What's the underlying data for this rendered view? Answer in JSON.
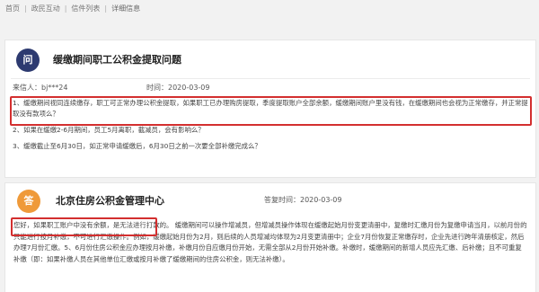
{
  "breadcrumb": {
    "items": [
      "首页",
      "政民互动",
      "信件列表",
      "详细信息"
    ]
  },
  "question": {
    "badge": "问",
    "title": "缓缴期间职工公积金提取问题",
    "sender_label": "来信人：bj***24",
    "time_label": "时间：2020-03-09",
    "items": [
      "1、缓缴期间视同连续缴存，职工可正常办理公积金提取，如果职工已办理购房提取，季度提取账户全部余额，缓缴期间账户里没有钱，在缓缴期间也会视为正常缴存，并正常提取没有款项么？",
      "2、如果在缓缴2-6月期间，员工5月离职，截减员，会有影响么？",
      "3、缓缴截止至6月30日，如正常申请缓缴后，6月30日之前一次要全部补缴完成么？"
    ]
  },
  "answer": {
    "badge": "答",
    "org": "北京住房公积金管理中心",
    "time_label": "答复时间：2020-03-09",
    "highlight": "您好，如果职工账户中没有余额，是无法进行打款的。",
    "body": "缓缴期间可以操作增减员，但增减员操作体现在缓缴起始月份变更清册中，复缴时汇缴月份为复缴申请当月，以前月份的只能进行按月补缴，不可进行汇缴操作。例如，缓缴起始月份为2月，则后续的人员增减均体现为2月变更清册中；企业7月份恢复正常缴存时，企业先进行跨年清册核定，然后办理7月份汇缴。5、6月份住房公积金应办理按月补缴，补缴月份自应缴月份开始，无需全部从2月份开始补缴。补缴时，缓缴期间的新增人员应先汇缴、后补缴；且不可重复补缴（即：如果补缴人员在其他单位汇缴或按月补缴了缓缴期间的住房公积金，则无法补缴）。"
  },
  "colors": {
    "highlight_border": "#d32f2f",
    "question_badge": "#2d3a70",
    "answer_badge": "#ef9a3a"
  }
}
